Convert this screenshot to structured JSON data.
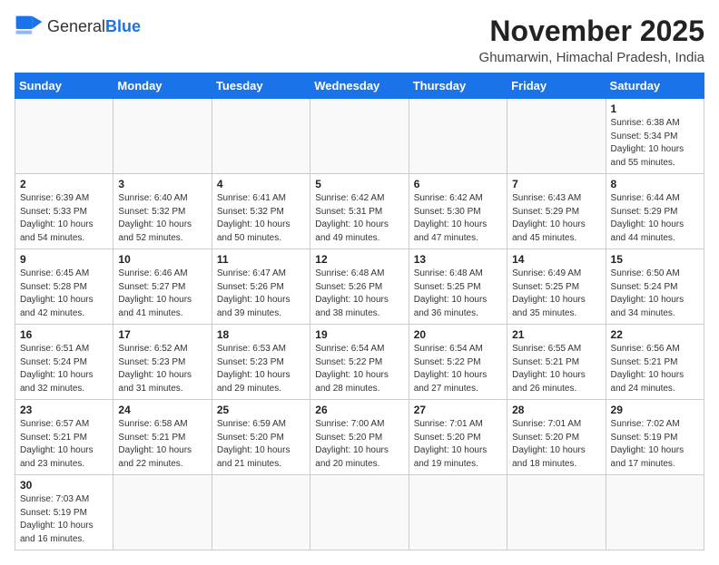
{
  "logo": {
    "text_general": "General",
    "text_blue": "Blue"
  },
  "title": "November 2025",
  "location": "Ghumarwin, Himachal Pradesh, India",
  "weekdays": [
    "Sunday",
    "Monday",
    "Tuesday",
    "Wednesday",
    "Thursday",
    "Friday",
    "Saturday"
  ],
  "weeks": [
    [
      {
        "day": "",
        "info": ""
      },
      {
        "day": "",
        "info": ""
      },
      {
        "day": "",
        "info": ""
      },
      {
        "day": "",
        "info": ""
      },
      {
        "day": "",
        "info": ""
      },
      {
        "day": "",
        "info": ""
      },
      {
        "day": "1",
        "info": "Sunrise: 6:38 AM\nSunset: 5:34 PM\nDaylight: 10 hours\nand 55 minutes."
      }
    ],
    [
      {
        "day": "2",
        "info": "Sunrise: 6:39 AM\nSunset: 5:33 PM\nDaylight: 10 hours\nand 54 minutes."
      },
      {
        "day": "3",
        "info": "Sunrise: 6:40 AM\nSunset: 5:32 PM\nDaylight: 10 hours\nand 52 minutes."
      },
      {
        "day": "4",
        "info": "Sunrise: 6:41 AM\nSunset: 5:32 PM\nDaylight: 10 hours\nand 50 minutes."
      },
      {
        "day": "5",
        "info": "Sunrise: 6:42 AM\nSunset: 5:31 PM\nDaylight: 10 hours\nand 49 minutes."
      },
      {
        "day": "6",
        "info": "Sunrise: 6:42 AM\nSunset: 5:30 PM\nDaylight: 10 hours\nand 47 minutes."
      },
      {
        "day": "7",
        "info": "Sunrise: 6:43 AM\nSunset: 5:29 PM\nDaylight: 10 hours\nand 45 minutes."
      },
      {
        "day": "8",
        "info": "Sunrise: 6:44 AM\nSunset: 5:29 PM\nDaylight: 10 hours\nand 44 minutes."
      }
    ],
    [
      {
        "day": "9",
        "info": "Sunrise: 6:45 AM\nSunset: 5:28 PM\nDaylight: 10 hours\nand 42 minutes."
      },
      {
        "day": "10",
        "info": "Sunrise: 6:46 AM\nSunset: 5:27 PM\nDaylight: 10 hours\nand 41 minutes."
      },
      {
        "day": "11",
        "info": "Sunrise: 6:47 AM\nSunset: 5:26 PM\nDaylight: 10 hours\nand 39 minutes."
      },
      {
        "day": "12",
        "info": "Sunrise: 6:48 AM\nSunset: 5:26 PM\nDaylight: 10 hours\nand 38 minutes."
      },
      {
        "day": "13",
        "info": "Sunrise: 6:48 AM\nSunset: 5:25 PM\nDaylight: 10 hours\nand 36 minutes."
      },
      {
        "day": "14",
        "info": "Sunrise: 6:49 AM\nSunset: 5:25 PM\nDaylight: 10 hours\nand 35 minutes."
      },
      {
        "day": "15",
        "info": "Sunrise: 6:50 AM\nSunset: 5:24 PM\nDaylight: 10 hours\nand 34 minutes."
      }
    ],
    [
      {
        "day": "16",
        "info": "Sunrise: 6:51 AM\nSunset: 5:24 PM\nDaylight: 10 hours\nand 32 minutes."
      },
      {
        "day": "17",
        "info": "Sunrise: 6:52 AM\nSunset: 5:23 PM\nDaylight: 10 hours\nand 31 minutes."
      },
      {
        "day": "18",
        "info": "Sunrise: 6:53 AM\nSunset: 5:23 PM\nDaylight: 10 hours\nand 29 minutes."
      },
      {
        "day": "19",
        "info": "Sunrise: 6:54 AM\nSunset: 5:22 PM\nDaylight: 10 hours\nand 28 minutes."
      },
      {
        "day": "20",
        "info": "Sunrise: 6:54 AM\nSunset: 5:22 PM\nDaylight: 10 hours\nand 27 minutes."
      },
      {
        "day": "21",
        "info": "Sunrise: 6:55 AM\nSunset: 5:21 PM\nDaylight: 10 hours\nand 26 minutes."
      },
      {
        "day": "22",
        "info": "Sunrise: 6:56 AM\nSunset: 5:21 PM\nDaylight: 10 hours\nand 24 minutes."
      }
    ],
    [
      {
        "day": "23",
        "info": "Sunrise: 6:57 AM\nSunset: 5:21 PM\nDaylight: 10 hours\nand 23 minutes."
      },
      {
        "day": "24",
        "info": "Sunrise: 6:58 AM\nSunset: 5:21 PM\nDaylight: 10 hours\nand 22 minutes."
      },
      {
        "day": "25",
        "info": "Sunrise: 6:59 AM\nSunset: 5:20 PM\nDaylight: 10 hours\nand 21 minutes."
      },
      {
        "day": "26",
        "info": "Sunrise: 7:00 AM\nSunset: 5:20 PM\nDaylight: 10 hours\nand 20 minutes."
      },
      {
        "day": "27",
        "info": "Sunrise: 7:01 AM\nSunset: 5:20 PM\nDaylight: 10 hours\nand 19 minutes."
      },
      {
        "day": "28",
        "info": "Sunrise: 7:01 AM\nSunset: 5:20 PM\nDaylight: 10 hours\nand 18 minutes."
      },
      {
        "day": "29",
        "info": "Sunrise: 7:02 AM\nSunset: 5:19 PM\nDaylight: 10 hours\nand 17 minutes."
      }
    ],
    [
      {
        "day": "30",
        "info": "Sunrise: 7:03 AM\nSunset: 5:19 PM\nDaylight: 10 hours\nand 16 minutes."
      },
      {
        "day": "",
        "info": ""
      },
      {
        "day": "",
        "info": ""
      },
      {
        "day": "",
        "info": ""
      },
      {
        "day": "",
        "info": ""
      },
      {
        "day": "",
        "info": ""
      },
      {
        "day": "",
        "info": ""
      }
    ]
  ]
}
